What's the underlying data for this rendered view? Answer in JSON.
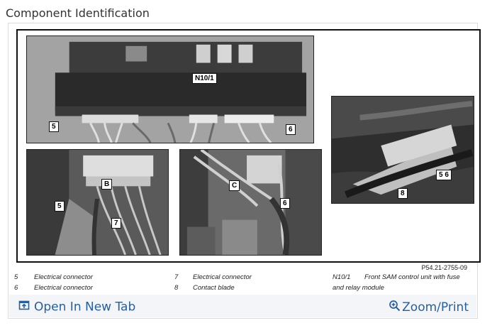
{
  "page": {
    "title": "Component Identification"
  },
  "figure": {
    "callouts": {
      "n10_1": "N10/1",
      "c5_top": "5",
      "c6_top": "6",
      "b": "B",
      "c5_left": "5",
      "c7": "7",
      "c": "C",
      "c6_mid": "6",
      "c56": "5 6",
      "c8": "8"
    },
    "code": "P54.21-2755-09"
  },
  "legend": {
    "items": [
      {
        "num": "5",
        "text": "Electrical connector"
      },
      {
        "num": "6",
        "text": "Electrical connector"
      },
      {
        "num": "7",
        "text": "Electrical connector"
      },
      {
        "num": "8",
        "text": "Contact blade"
      },
      {
        "num": "N10/1",
        "text": "Front SAM control unit with fuse"
      },
      {
        "num": "",
        "text": "and relay module"
      }
    ]
  },
  "footer": {
    "open_label": "Open In New Tab",
    "zoom_label": "Zoom/Print",
    "accent": "#2a5f96"
  }
}
